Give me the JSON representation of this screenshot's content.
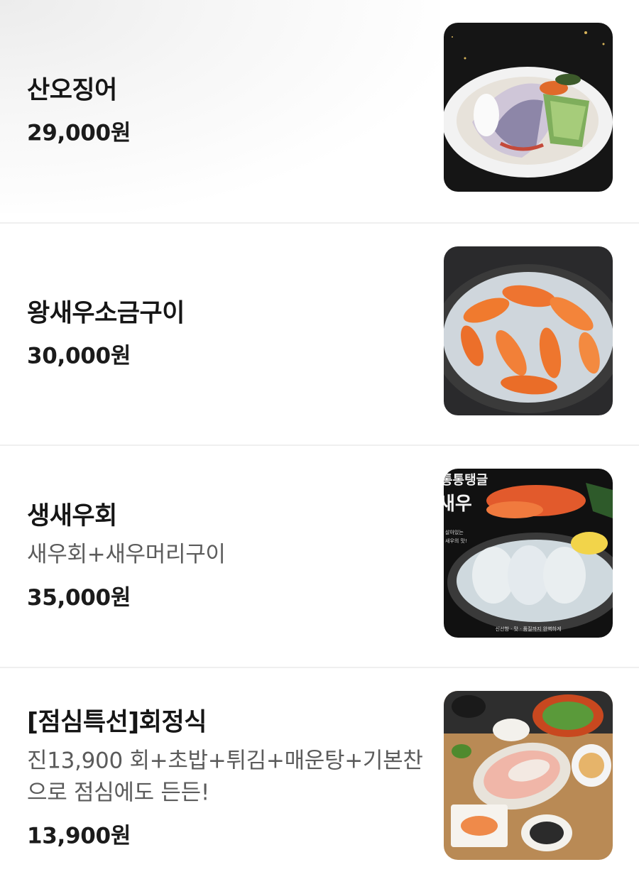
{
  "menu": {
    "items": [
      {
        "name": "산오징어",
        "description": "",
        "price": "29,000원",
        "image": "squid-sashimi-platter-image"
      },
      {
        "name": "왕새우소금구이",
        "description": "",
        "price": "30,000원",
        "image": "salt-grilled-king-prawns-image"
      },
      {
        "name": "생새우회",
        "description": "새우회+새우머리구이",
        "price": "35,000원",
        "image": "raw-shrimp-sashimi-image",
        "image_text": [
          "통통탱글",
          "새우",
          "살아있는",
          "새우의 맛!",
          "신선함 · 맛 · 품질까지 완벽하게"
        ]
      },
      {
        "name": "[점심특선]회정식",
        "description": "진13,900 회+초밥+튀김+매운탕+기본찬으로 점심에도 든든!",
        "price": "13,900원",
        "image": "lunch-set-meal-image"
      }
    ]
  },
  "colors": {
    "text": "#161616",
    "description": "#5b5b5b",
    "divider": "#efefef"
  }
}
